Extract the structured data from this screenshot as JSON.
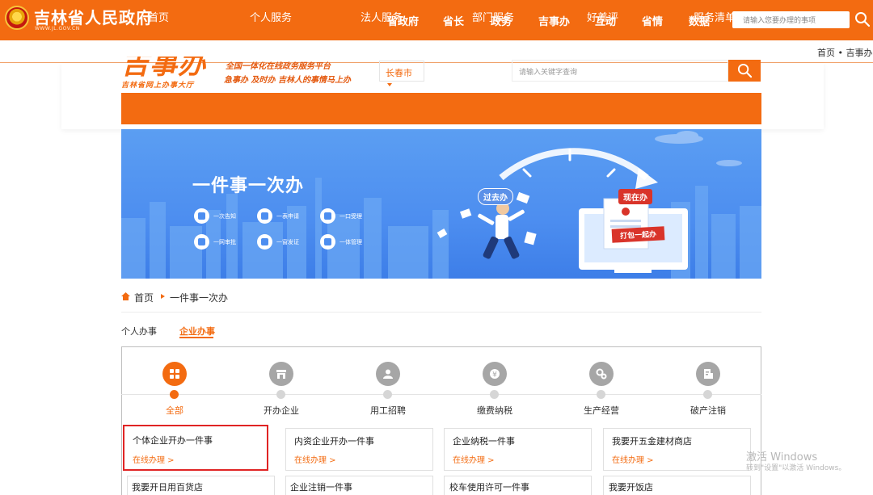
{
  "gov_header": {
    "title": "吉林省人民政府",
    "subtitle": "WWW.JL.GOV.CN",
    "nav": [
      "省政府",
      "省长",
      "政务",
      "吉事办",
      "互动",
      "省情",
      "数据"
    ],
    "search_placeholder": "请输入您要办理的事项"
  },
  "top_breadcrumb": "首页 • 吉事办",
  "brand": {
    "logo": "吉事办",
    "logo_sub": "吉林省网上办事大厅",
    "slogan_line1": "全国一体化在线政务服务平台",
    "slogan_line2": "急事办 及时办 吉林人的事情马上办",
    "city": "长春市",
    "search_placeholder": "请输入关键字查询"
  },
  "main_nav": [
    "首页",
    "个人服务",
    "法人服务",
    "部门服务",
    "好差评",
    "服务清单"
  ],
  "banner": {
    "title": "一件事一次办",
    "features": [
      "一次告知",
      "一表申请",
      "一口受理",
      "一网审批",
      "一窗发证",
      "一体管理"
    ],
    "tag_past": "过去办",
    "tag_now": "现在办",
    "tag_pack": "打包一起办"
  },
  "breadcrumb": {
    "home": "首页",
    "current": "一件事一次办"
  },
  "tabs": {
    "personal": "个人办事",
    "enterprise": "企业办事"
  },
  "categories": [
    "全部",
    "开办企业",
    "用工招聘",
    "缴费纳税",
    "生产经营",
    "破产注销"
  ],
  "active_category": "全部",
  "cards_row1": [
    {
      "title": "个体企业开办一件事",
      "link": "在线办理 >"
    },
    {
      "title": "内资企业开办一件事",
      "link": "在线办理 >"
    },
    {
      "title": "企业纳税一件事",
      "link": "在线办理 >"
    },
    {
      "title": "我要开五金建材商店",
      "link": "在线办理 >"
    }
  ],
  "cards_row2": [
    "我要开日用百货店",
    "企业注销一件事",
    "校车使用许可一件事",
    "我要开饭店"
  ],
  "watermark": {
    "line1": "激活 Windows",
    "line2": "转到\"设置\"以激活 Windows。"
  },
  "colors": {
    "brand_orange": "#f36b11",
    "banner_blue": "#4d8ef0",
    "highlight_red": "#e02424"
  }
}
